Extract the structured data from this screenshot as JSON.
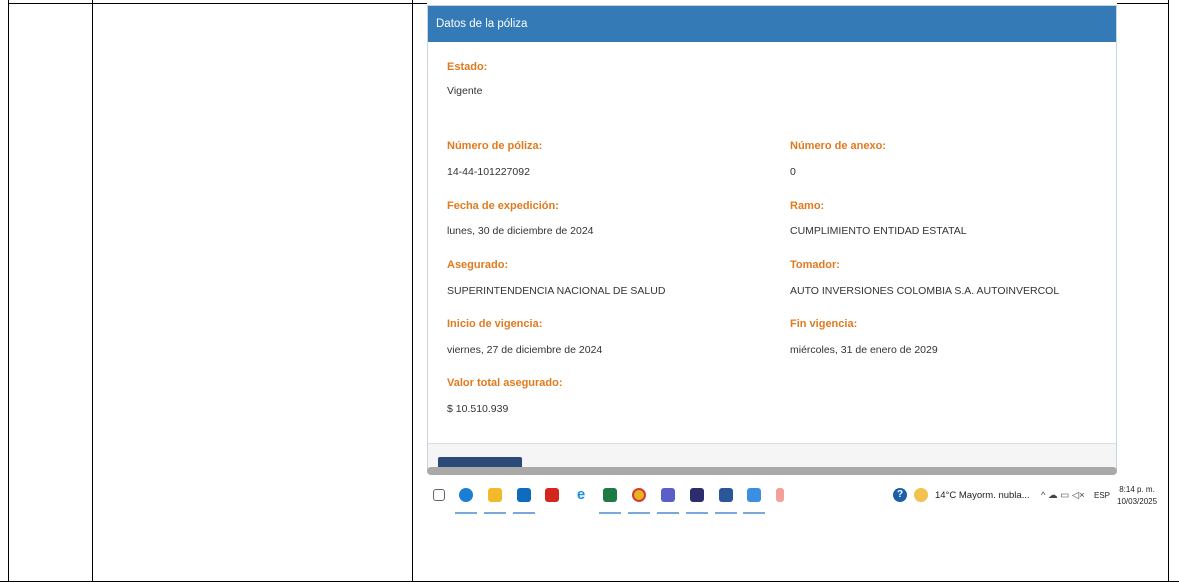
{
  "panel": {
    "title": "Datos de la póliza",
    "estado_label": "Estado:",
    "estado_value": "Vigente",
    "numero_poliza_label": "Número de póliza:",
    "numero_poliza_value": "14-44-101227092",
    "numero_anexo_label": "Número de anexo:",
    "numero_anexo_value": "0",
    "fecha_expedicion_label": "Fecha de expedición:",
    "fecha_expedicion_value": "lunes, 30 de diciembre de 2024",
    "ramo_label": "Ramo:",
    "ramo_value": "CUMPLIMIENTO ENTIDAD ESTATAL",
    "asegurado_label": "Asegurado:",
    "asegurado_value": "SUPERINTENDENCIA NACIONAL DE SALUD",
    "tomador_label": "Tomador:",
    "tomador_value": "AUTO INVERSIONES COLOMBIA S.A. AUTOINVERCOL",
    "inicio_vigencia_label": "Inicio de vigencia:",
    "inicio_vigencia_value": "viernes, 27 de diciembre de 2024",
    "fin_vigencia_label": "Fin vigencia:",
    "fin_vigencia_value": "miércoles, 31 de enero de 2029",
    "valor_total_label": "Valor total asegurado:",
    "valor_total_value": "$ 10.510.939"
  },
  "taskbar": {
    "weather_text": "14°C  Mayorm. nubla...",
    "language": "ESP",
    "time": "8:14 p. m.",
    "date": "10/03/2025",
    "icons": [
      "task-view-icon",
      "edge-icon",
      "file-explorer-icon",
      "outlook-icon",
      "acrobat-icon",
      "internet-explorer-icon",
      "excel-icon",
      "chrome-icon",
      "teams-icon",
      "app-icon",
      "word-icon",
      "photos-icon",
      "pinned-app-icon"
    ]
  },
  "colors": {
    "header_blue": "#337ab7",
    "label_orange": "#e07a1f",
    "footer_button": "#2c4a78"
  }
}
